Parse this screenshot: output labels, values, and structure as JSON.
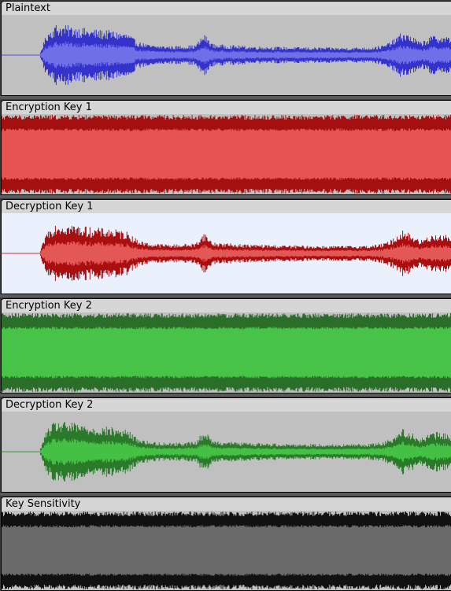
{
  "tracks": [
    {
      "label": "Plaintext",
      "kind": "speech",
      "background": "#c0c0c0",
      "outer_color": "#3333cc",
      "inner_color": "#6f6fe8"
    },
    {
      "label": "Encryption Key 1",
      "kind": "noise",
      "background": "#c0c0c0",
      "outer_color": "#a40f0f",
      "inner_color": "#e65353"
    },
    {
      "label": "Decryption Key 1",
      "kind": "speech",
      "background": "#eaf0fc",
      "outer_color": "#aa0e0e",
      "inner_color": "#e45757"
    },
    {
      "label": "Encryption Key 2",
      "kind": "noise",
      "background": "#c0c0c0",
      "outer_color": "#2a6e2a",
      "inner_color": "#47c447"
    },
    {
      "label": "Decryption Key 2",
      "kind": "speech",
      "background": "#c0c0c0",
      "outer_color": "#2a7a2a",
      "inner_color": "#44c044"
    },
    {
      "label": "Key Sensitivity",
      "kind": "noise",
      "background": "#c0c0c0",
      "outer_color": "#111111",
      "inner_color": "#6a6a6a"
    }
  ]
}
